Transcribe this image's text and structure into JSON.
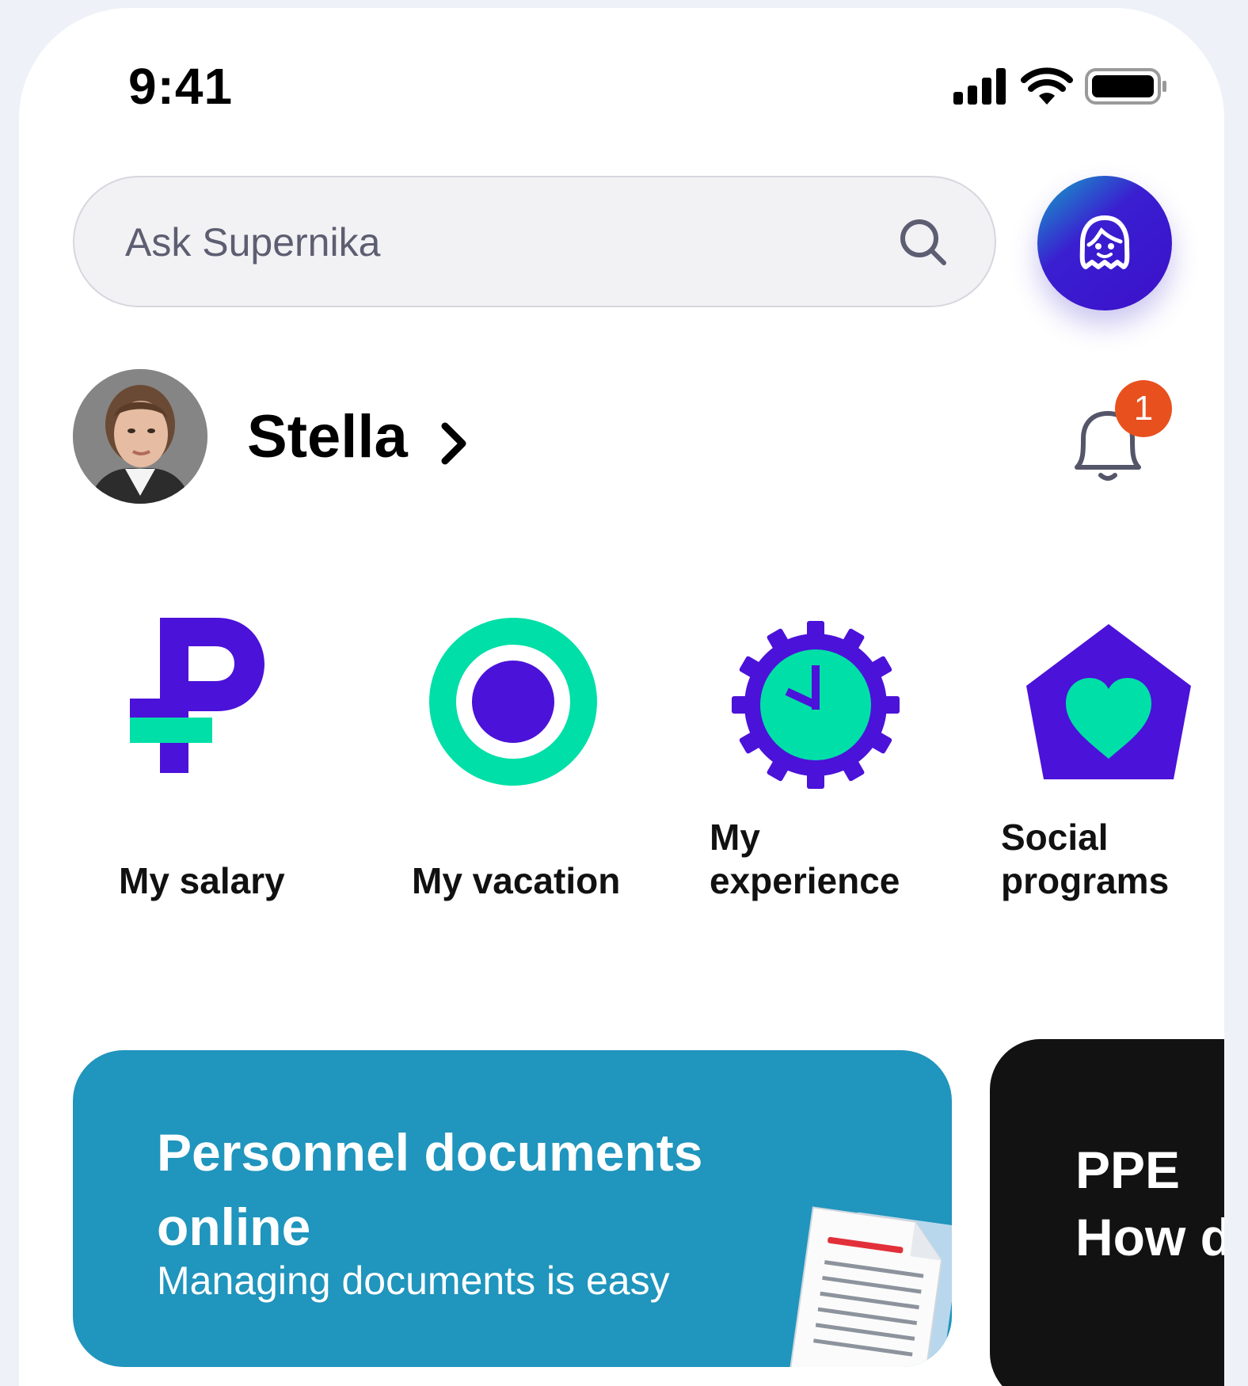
{
  "status_bar": {
    "time": "9:41",
    "icons": [
      "signal-icon",
      "wifi-icon",
      "battery-icon"
    ]
  },
  "search": {
    "placeholder": "Ask Supernika"
  },
  "assistant": {
    "icon": "assistant-icon"
  },
  "profile": {
    "name": "Stella",
    "notifications_count": "1"
  },
  "quick_actions": [
    {
      "label": "My salary",
      "icon": "ruble-icon"
    },
    {
      "label": "My vacation",
      "icon": "vacation-ring-icon"
    },
    {
      "label": "My experience",
      "icon": "gear-clock-icon"
    },
    {
      "label": "Social programs",
      "icon": "pentagon-heart-icon"
    }
  ],
  "cards": [
    {
      "title": "Personnel documents online",
      "subtitle": "Managing documents is easy",
      "color": "#2095bd"
    },
    {
      "title": "PPE",
      "subtitle": "How d",
      "color": "#121212"
    }
  ],
  "colors": {
    "purple": "#4b12d9",
    "mint": "#00dfa7",
    "badge": "#e8501e"
  }
}
